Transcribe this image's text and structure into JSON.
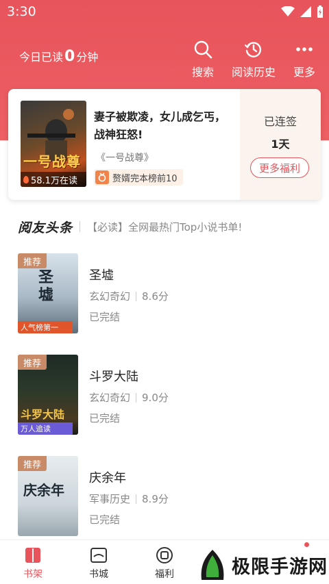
{
  "status_bar": {
    "time": "3:30"
  },
  "header": {
    "read_today_prefix": "今日已读",
    "read_today_minutes": "0",
    "read_today_suffix": "分钟",
    "actions": [
      {
        "label": "搜索",
        "icon": "search-icon"
      },
      {
        "label": "阅读历史",
        "icon": "history-icon"
      },
      {
        "label": "更多",
        "icon": "more-icon"
      }
    ]
  },
  "featured": {
    "cover_title": "一号战尊",
    "readers": "58.1万在读",
    "headline": "妻子被欺凌，女儿成乞丐，战神狂怒!",
    "book_name": "《一号战尊》",
    "rank_text": "赘婿完本榜前10",
    "checkin_label": "已连签",
    "checkin_days": "1天",
    "more_benefit": "更多福利"
  },
  "news": {
    "logo": "阅友头条",
    "text": "【必读】全网最热门Top小说书单!"
  },
  "books": [
    {
      "tag": "推荐",
      "title": "圣墟",
      "genre": "玄幻奇幻",
      "score": "8.6分",
      "status": "已完结",
      "cover_text": "圣墟",
      "ribbon": "人气榜第一",
      "ribbon_color": "#e0552a"
    },
    {
      "tag": "推荐",
      "title": "斗罗大陆",
      "genre": "玄幻奇幻",
      "score": "9.0分",
      "status": "已完结",
      "cover_text": "斗罗大陆",
      "ribbon": "万人追读",
      "ribbon_color": "#6b5bd6"
    },
    {
      "tag": "推荐",
      "title": "庆余年",
      "genre": "军事历史",
      "score": "8.9分",
      "status": "已完结",
      "cover_text": "庆余年",
      "ribbon": "",
      "ribbon_color": ""
    }
  ],
  "bottom_nav": [
    {
      "label": "书架",
      "icon": "bookshelf-icon",
      "active": true
    },
    {
      "label": "书城",
      "icon": "bookstore-icon",
      "active": false
    },
    {
      "label": "福利",
      "icon": "benefit-icon",
      "active": false
    }
  ],
  "watermark": {
    "text": "极限手游网"
  },
  "colors": {
    "accent": "#e8545b",
    "tag": "#c98a67"
  }
}
